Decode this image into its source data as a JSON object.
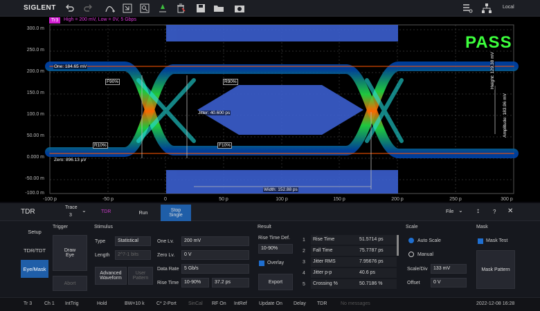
{
  "toolbar": {
    "brand": "SIGLENT",
    "local": "Local"
  },
  "trace": {
    "badge": "Tr3",
    "info": "High = 200 mV, Low = 0V, 5 Gbps"
  },
  "y_ticks": [
    "300.0 m",
    "250.0 m",
    "200.0 m",
    "150.0 m",
    "100.0 m",
    "50.00 m",
    "0.000 m",
    "-50.00 m",
    "-100.0 m"
  ],
  "x_ticks": [
    "-100 p",
    "-50 p",
    "0",
    "50 p",
    "100 p",
    "150 p",
    "200 p",
    "250 p",
    "300 p"
  ],
  "eye": {
    "one": "One: 184.65 mV",
    "zero": "Zero: 896.13 µV",
    "f90": "F90%",
    "r90": "R90%",
    "r10": "R10%",
    "f10": "F10%",
    "jitter": "Jitter: 40.600 ps",
    "width": "Width: 152.88 ps",
    "height": "Height: 129.38 mV",
    "amplitude": "Amplitude: 183.96 mV",
    "pass": "PASS"
  },
  "panel": {
    "title": "TDR",
    "trace_label": "Trace",
    "trace_value": "3",
    "tdr_tag": "TDR",
    "run": "Run",
    "stop": "Stop",
    "single": "Single",
    "file": "File",
    "side_tabs": [
      "Setup",
      "TDR/TDT",
      "Eye/Mask"
    ],
    "trigger": {
      "title": "Trigger",
      "draw_eye": "Draw\nEye",
      "abort": "Abort"
    },
    "stimulus": {
      "title": "Stimulus",
      "type_label": "Type",
      "type_value": "Statistical",
      "length_label": "Length",
      "length_value": "2^7-1 bits",
      "adv": "Advanced\nWaveform",
      "user": "User\nPattern",
      "one_lv_label": "One Lv.",
      "one_lv": "200 mV",
      "zero_lv_label": "Zero Lv.",
      "zero_lv": "0 V",
      "rate_label": "Data Rate",
      "rate": "5 Gb/s",
      "rise_label": "Rise Time",
      "rise_mode": "10-90%",
      "rise_value": "37.2 ps"
    },
    "result": {
      "title": "Result",
      "rtd_label": "Rise Time Def.",
      "rtd_value": "10-90%",
      "overlay": "Overlay",
      "export": "Export",
      "rows": [
        {
          "n": "1",
          "name": "Rise Time",
          "val": "51.5714 ps"
        },
        {
          "n": "2",
          "name": "Fall Time",
          "val": "75.7787 ps"
        },
        {
          "n": "3",
          "name": "Jitter RMS",
          "val": "7.95676 ps"
        },
        {
          "n": "4",
          "name": "Jitter p-p",
          "val": "40.6 ps"
        },
        {
          "n": "5",
          "name": "Crossing %",
          "val": "50.7186 %"
        }
      ]
    },
    "scale": {
      "title": "Scale",
      "auto": "Auto Scale",
      "manual": "Manual",
      "sdiv_label": "Scale/Div",
      "sdiv": "133 mV",
      "offset_label": "Offset",
      "offset": "0 V"
    },
    "mask": {
      "title": "Mask",
      "test": "Mask Test",
      "pattern": "Mask Pattern"
    }
  },
  "status": {
    "items": [
      "Tr 3",
      "Ch 1",
      "IntTrig",
      "Hold",
      "BW=10 k",
      "C* 2-Port",
      "SinCal",
      "RF On",
      "IntRef",
      "Update On",
      "Delay",
      "TDR",
      "No messages"
    ],
    "time": "2022-12-08 16:28"
  }
}
